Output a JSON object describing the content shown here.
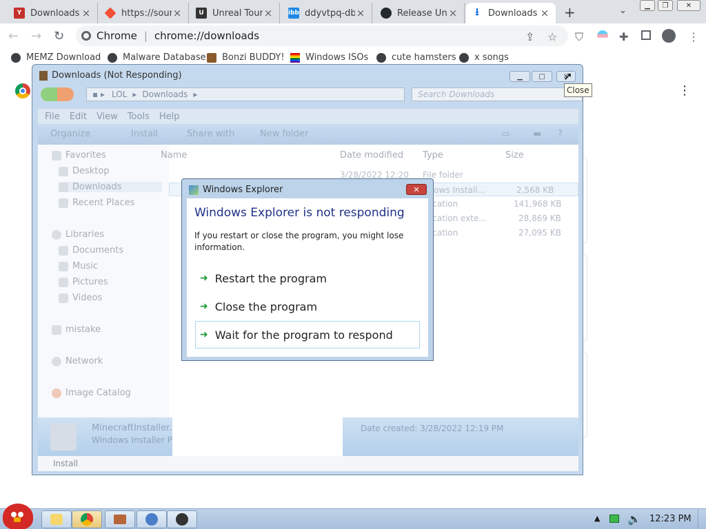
{
  "tabs": [
    {
      "title": "Downloads",
      "favicon": "youtube-red-icon",
      "color": "#c4302b"
    },
    {
      "title": "https://sour",
      "favicon": "git-diamond-icon",
      "color": "#f05033"
    },
    {
      "title": "Unreal Tour",
      "favicon": "unreal-icon",
      "color": "#333333"
    },
    {
      "title": "ddyvtpq-db",
      "favicon": "ibb-icon",
      "color": "#1e88e5",
      "fav_text": "ibb"
    },
    {
      "title": "Release Uni",
      "favicon": "github-icon",
      "color": "#24292e"
    },
    {
      "title": "Downloads",
      "favicon": "download-icon",
      "color": "#1a73e8",
      "active": true
    }
  ],
  "omnibox": {
    "site": "Chrome",
    "url": "chrome://downloads"
  },
  "bookmarks": [
    "MEMZ Download",
    "Malware Database",
    "Bonzi BUDDY!",
    "Windows ISOs",
    "cute hamsters",
    "x songs"
  ],
  "explorer": {
    "title": "Downloads (Not Responding)",
    "breadcrumb": [
      "LOL",
      "Downloads"
    ],
    "search_placeholder": "Search Downloads",
    "menu": [
      "File",
      "Edit",
      "View",
      "Tools",
      "Help"
    ],
    "commands": [
      "Organize",
      "Install",
      "Share with",
      "New folder"
    ],
    "nav": {
      "favorites": "Favorites",
      "favorites_items": [
        "Desktop",
        "Downloads",
        "Recent Places"
      ],
      "libraries": "Libraries",
      "libraries_items": [
        "Documents",
        "Music",
        "Pictures",
        "Videos"
      ],
      "user": "mistake",
      "network": "Network",
      "catalog": "Image Catalog"
    },
    "columns": [
      "Name",
      "Date modified",
      "Type",
      "Size"
    ],
    "files": [
      {
        "date": "3/28/2022 12:20",
        "type": "File folder",
        "size": ""
      },
      {
        "date": "",
        "type": "ndows Install...",
        "size": "2,568 KB"
      },
      {
        "date": "",
        "type": "plication",
        "size": "141,968 KB"
      },
      {
        "date": "",
        "type": "plication exte...",
        "size": "28,869 KB"
      },
      {
        "date": "",
        "type": "plication",
        "size": "27,095 KB"
      }
    ],
    "details": {
      "name": "MinecraftInstaller.r",
      "kind": "Windows Installer P",
      "date_created": "Date created: 3/28/2022 12:19 PM"
    },
    "status": "Install"
  },
  "tooltip": "Close",
  "dialog": {
    "title": "Windows Explorer",
    "heading": "Windows Explorer is not responding",
    "message": "If you restart or close the program, you might lose information.",
    "options": [
      "Restart the program",
      "Close the program",
      "Wait for the program to respond"
    ]
  },
  "clock": "12:23 PM"
}
